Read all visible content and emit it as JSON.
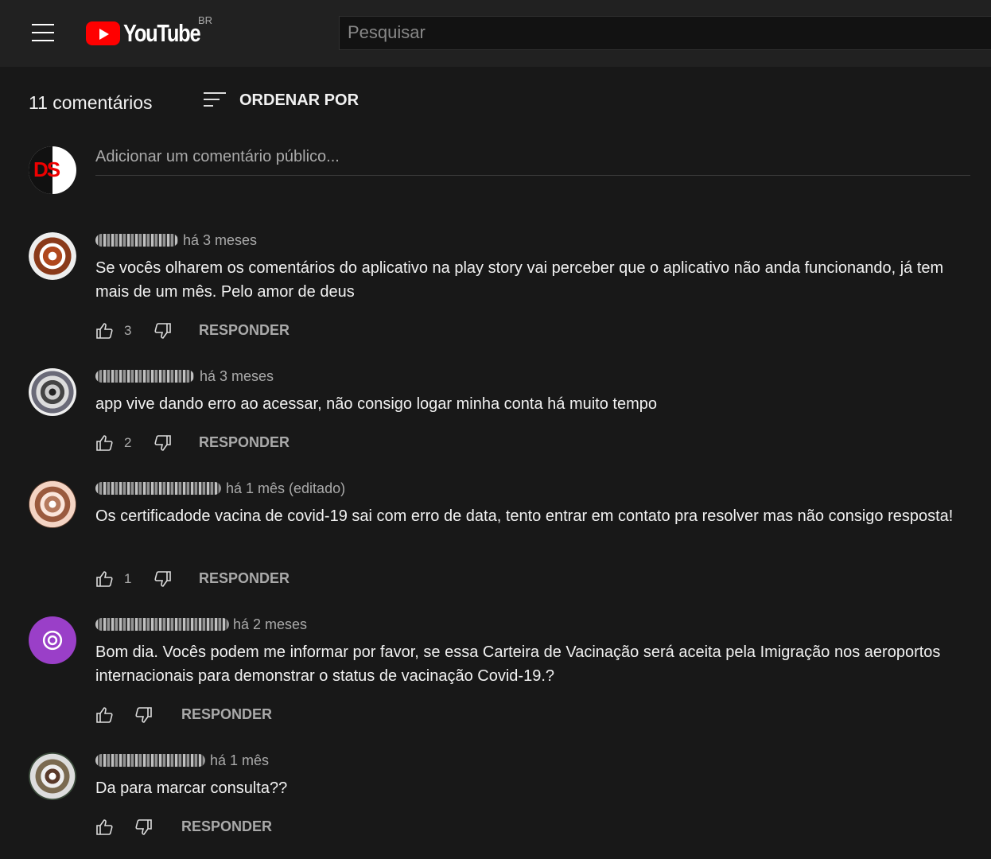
{
  "header": {
    "logo_text": "YouTube",
    "country_code": "BR",
    "search_placeholder": "Pesquisar"
  },
  "comments_section": {
    "count_label": "11 comentários",
    "sort_label": "ORDENAR POR",
    "add_comment_placeholder": "Adicionar um comentário público..."
  },
  "current_user": {
    "avatar_text": "DS"
  },
  "comments": [
    {
      "time": "há 3 meses",
      "text": "Se vocês olharem os comentários do aplicativo na play story vai perceber que o aplicativo não anda funcionando, já tem mais de um mês. Pelo amor de deus",
      "likes": "3",
      "reply_label": "RESPONDER",
      "avatar_color": "#b0481e"
    },
    {
      "time": "há 3 meses",
      "text": "app vive dando erro ao acessar, não consigo logar minha conta há muito tempo",
      "likes": "2",
      "reply_label": "RESPONDER",
      "avatar_color": "#6a6a78"
    },
    {
      "time": "há 1 mês (editado)",
      "text": "Os certificadode vacina de covid-19 sai com erro de data, tento entrar em contato pra resolver mas não consigo resposta!",
      "likes": "1",
      "reply_label": "RESPONDER",
      "avatar_color": "#b57a5e"
    },
    {
      "time": "há 2 meses",
      "text": "Bom dia. Vocês podem me informar por favor, se essa Carteira de Vacinação será aceita pela Imigração nos aeroportos internacionais para demonstrar o status de vacinação Covid-19.?",
      "likes": "",
      "reply_label": "RESPONDER",
      "avatar_color": "#9a3fc8"
    },
    {
      "time": "há 1 mês",
      "text": "Da para marcar consulta??",
      "likes": "",
      "reply_label": "RESPONDER",
      "avatar_color": "#7a6a50"
    }
  ]
}
